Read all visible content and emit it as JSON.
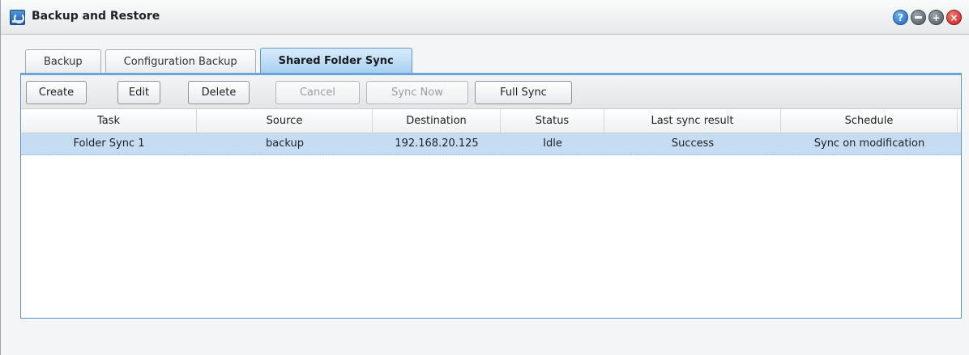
{
  "window": {
    "title": "Backup and Restore",
    "icon": "backup-restore-app-icon",
    "controls": {
      "help": "?",
      "minimize": "",
      "maximize": "+",
      "close": "×"
    }
  },
  "tabs": [
    {
      "label": "Backup",
      "active": false
    },
    {
      "label": "Configuration Backup",
      "active": false
    },
    {
      "label": "Shared Folder Sync",
      "active": true
    }
  ],
  "toolbar": {
    "create": "Create",
    "edit": "Edit",
    "delete": "Delete",
    "cancel": "Cancel",
    "sync_now": "Sync Now",
    "full_sync": "Full Sync",
    "disabled": [
      "Cancel",
      "Sync Now"
    ]
  },
  "table": {
    "columns": [
      "Task",
      "Source",
      "Destination",
      "Status",
      "Last sync result",
      "Schedule"
    ],
    "rows": [
      [
        "Folder Sync 1",
        "backup",
        "192.168.20.125",
        "Idle",
        "Success",
        "Sync on modification"
      ]
    ],
    "selected_row": 0
  },
  "colors": {
    "accent": "#6aa6dd",
    "selected_row": "#c6dcf3",
    "close": "#c81f1f"
  }
}
